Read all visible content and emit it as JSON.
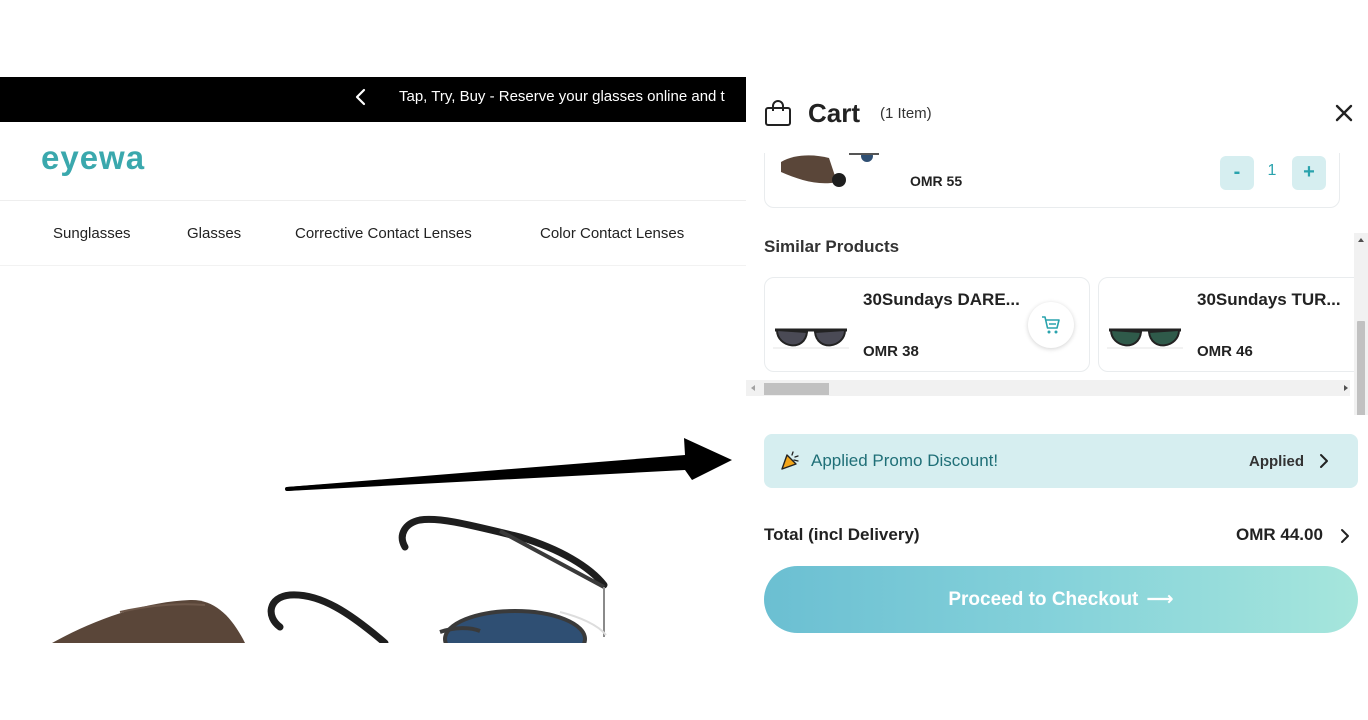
{
  "site": {
    "announcement": "Tap, Try, Buy - Reserve your glasses online and t",
    "logo_text": "eyewa",
    "nav": [
      "Sunglasses",
      "Glasses",
      "Corrective Contact Lenses",
      "Color Contact Lenses"
    ]
  },
  "cart": {
    "title": "Cart",
    "count": "(1 Item)",
    "item": {
      "price": "OMR 55",
      "quantity": "1",
      "minus": "-",
      "plus": "+"
    },
    "similar_title": "Similar Products",
    "similar": [
      {
        "name": "30Sundays DARE...",
        "price": "OMR 38"
      },
      {
        "name": "30Sundays TUR...",
        "price": "OMR 46"
      }
    ],
    "promo": {
      "label": "Applied Promo Discount!",
      "status": "Applied"
    },
    "total_label": "Total (incl Delivery)",
    "total_value": "OMR 44.00",
    "checkout_label": "Proceed to Checkout",
    "checkout_arrow": "⟶"
  },
  "colors": {
    "brand_teal": "#2aa3ad",
    "promo_bg": "#d6eef0",
    "announce_bg": "#000000"
  },
  "icons": [
    "chevron-left-icon",
    "bag-icon",
    "close-icon",
    "cart-add-icon",
    "promo-tag-icon",
    "chevron-right-icon"
  ]
}
